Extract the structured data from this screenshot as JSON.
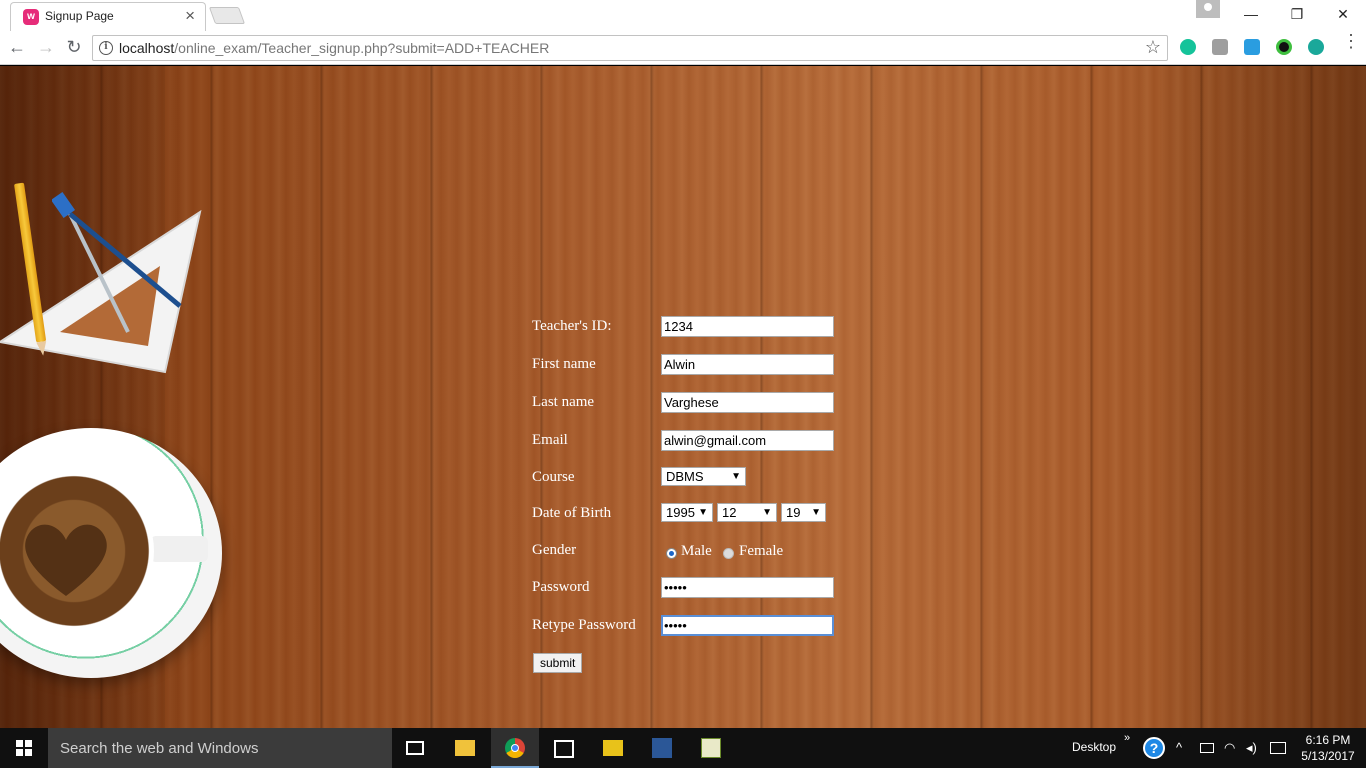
{
  "browser": {
    "tab_title": "Signup Page",
    "tab_close": "×",
    "favicon_text": "w",
    "url_host": "localhost",
    "url_path": "/online_exam/Teacher_signup.php?submit=ADD+TEACHER",
    "window_minimize": "—",
    "window_restore": "❐",
    "window_close": "✕"
  },
  "form": {
    "fields": [
      {
        "label": "Teacher's ID:",
        "value": "1234"
      },
      {
        "label": "First name",
        "value": "Alwin"
      },
      {
        "label": "Last name",
        "value": "Varghese"
      },
      {
        "label": "Email",
        "value": "alwin@gmail.com"
      }
    ],
    "course": {
      "label": "Course",
      "selected": "DBMS"
    },
    "dob": {
      "label": "Date of Birth",
      "year": "1995",
      "month": "12",
      "day": "19"
    },
    "gender": {
      "label": "Gender",
      "options": [
        "Male",
        "Female"
      ],
      "selected": "Male"
    },
    "password": {
      "label": "Password",
      "value": "•••••"
    },
    "retype_password": {
      "label": "Retype Password",
      "value": "•••••"
    },
    "submit_label": "submit"
  },
  "taskbar": {
    "search_placeholder": "Search the web and Windows",
    "desktop_label": "Desktop",
    "time": "6:16 PM",
    "date": "5/13/2017"
  },
  "colors": {
    "wood": "#a5592a",
    "chrome_bg": "#ffffff",
    "taskbar_bg": "#101010"
  }
}
